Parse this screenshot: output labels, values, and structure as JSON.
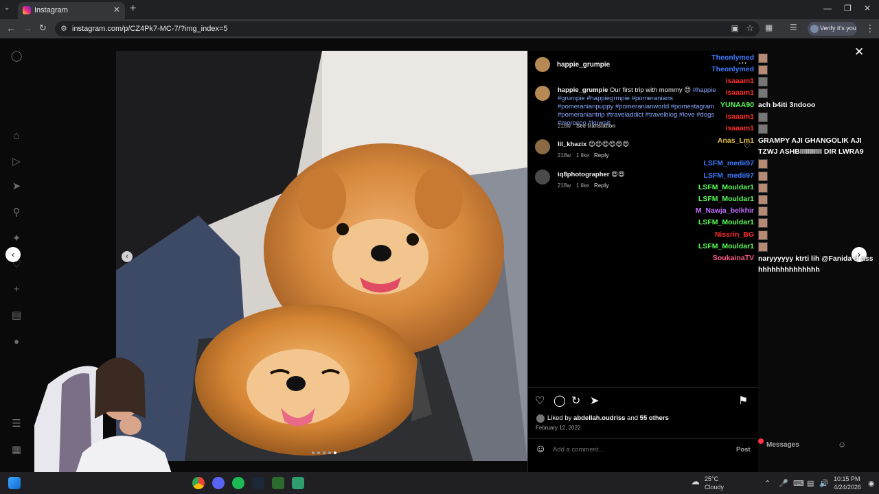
{
  "browser": {
    "tab_title": "Instagram",
    "url": "instagram.com/p/CZ4Pk7-MC-7/?img_index=5",
    "verify_label": "Verify it's you"
  },
  "post": {
    "author": "happie_grumpie",
    "caption_user": "happie_grumpie",
    "caption_text": "Our first trip with mommy",
    "caption_tags": "#happie #grumpie #happiegrmpie #pomeranians #pomeranianpuppy #pomeranianworld #pomestagram #pomeraniantrip #traveladdict #travelblog #love #dogs #morocco #kuwait",
    "caption_meta": "218w",
    "see_translation": "See translation",
    "comments": [
      {
        "user": "lil_khazix",
        "text": "😍😍😍😍😍😍",
        "age": "218w",
        "likes": "1 like",
        "reply": "Reply"
      },
      {
        "user": "iq8photographer",
        "text": "😍😍",
        "age": "218w",
        "likes": "1 like",
        "reply": "Reply"
      }
    ],
    "liked_by_prefix": "Liked by",
    "liked_by_user": "abdellah.oudriss",
    "liked_by_and": "and",
    "liked_by_others": "55 others",
    "date": "February 12, 2022",
    "comment_placeholder": "Add a comment...",
    "post_button": "Post",
    "carousel_dots": 5,
    "active_dot": 5
  },
  "chat": {
    "lines": [
      {
        "name": "Theonlymed",
        "color": "#3e7bff"
      },
      {
        "name": "Theonlymed",
        "color": "#3e7bff"
      },
      {
        "name": "isaaam1",
        "color": "#ff2e2e"
      },
      {
        "name": "isaaam1",
        "color": "#ff2e2e"
      },
      {
        "name": "YUNAA90",
        "color": "#5cff5c"
      },
      {
        "name": "isaaam1",
        "color": "#ff2e2e"
      },
      {
        "name": "isaaam1",
        "color": "#ff2e2e"
      },
      {
        "name": "Anas_Lm1",
        "color": "#e8c34a"
      },
      {
        "name": "LSFM_medii97",
        "color": "#3e7bff"
      },
      {
        "name": "LSFM_medii97",
        "color": "#3e7bff"
      },
      {
        "name": "LSFM_Mouldar1",
        "color": "#5cff5c"
      },
      {
        "name": "LSFM_Mouldar1",
        "color": "#5cff5c"
      },
      {
        "name": "M_Nawja_belkhir",
        "color": "#c470ff"
      },
      {
        "name": "LSFM_Mouldar1",
        "color": "#5cff5c"
      },
      {
        "name": "Nissrin_BG",
        "color": "#ff2e2e"
      },
      {
        "name": "LSFM_Mouldar1",
        "color": "#5cff5c"
      },
      {
        "name": "SoukainaTV",
        "color": "#ff5c8a"
      }
    ],
    "messages": {
      "m1": "ach b4iti 3ndooo",
      "m2a": "GRAMPY AJI GHANGOLIK AJI",
      "m2b": "TZWJ ASHBIIIIIIIIIII DIR LWRA9",
      "m3a": "naryyyyyy ktrti lih @Fanida d",
      "m3b": "hhhhhhhhhhhhhh",
      "m3c": "ass"
    }
  },
  "messages_bar": {
    "label": "Messages"
  },
  "taskbar": {
    "weather_temp": "25°C",
    "weather_desc": "Cloudy",
    "time": "10:15 PM",
    "date": "4/24/2026"
  },
  "icons": [
    "instagram-icon",
    "home-icon",
    "reels-icon",
    "messenger-icon",
    "search-icon",
    "explore-icon",
    "heart-icon",
    "create-icon",
    "dashboard-icon",
    "profile-icon",
    "menu-icon",
    "more-icon"
  ],
  "accent": "#0095f6"
}
